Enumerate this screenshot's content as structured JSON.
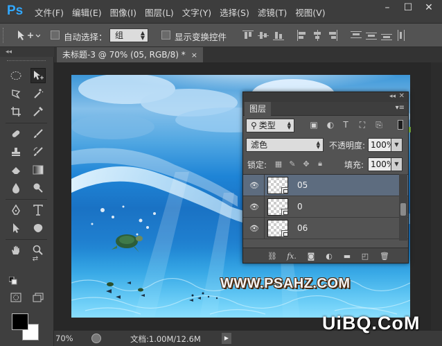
{
  "app": {
    "logo": "Ps",
    "accent": "#31a8ff"
  },
  "menu": {
    "items": [
      "文件(F)",
      "编辑(E)",
      "图像(I)",
      "图层(L)",
      "文字(Y)",
      "选择(S)",
      "滤镜(T)",
      "视图(V)"
    ]
  },
  "window_controls": {
    "minimize": "–",
    "maximize": "☐",
    "close": "✕"
  },
  "options": {
    "auto_select_label": "自动选择：",
    "auto_select_value": "组",
    "show_transform_label": "显示变换控件"
  },
  "tools_strip": {
    "collapse": "◂◂"
  },
  "document": {
    "tab_title": "未标题-3 @ 70% (05, RGB/8) *",
    "tab_close": "×"
  },
  "status": {
    "zoom": "70%",
    "doc_info": "文档:1.00M/12.6M",
    "arrow": "▶"
  },
  "layers_panel": {
    "collapse": "◂◂",
    "close": "✕",
    "tab": "图层",
    "kind_filter": "类型",
    "blend_mode": "滤色",
    "opacity_label": "不透明度:",
    "opacity_value": "100%",
    "lock_label": "锁定:",
    "fill_label": "填充:",
    "fill_value": "100%",
    "layers": [
      {
        "name": "05",
        "selected": true,
        "visible": true
      },
      {
        "name": "0",
        "selected": false,
        "visible": true
      },
      {
        "name": "06",
        "selected": false,
        "visible": true
      }
    ],
    "bottom_icons": [
      "link-icon",
      "fx-icon",
      "mask-icon",
      "adjustment-icon",
      "folder-icon",
      "new-layer-icon",
      "trash-icon"
    ]
  },
  "canvas": {
    "watermark": "WWW.PSAHZ.COM"
  },
  "site_watermark": "UiBQ.CoM"
}
